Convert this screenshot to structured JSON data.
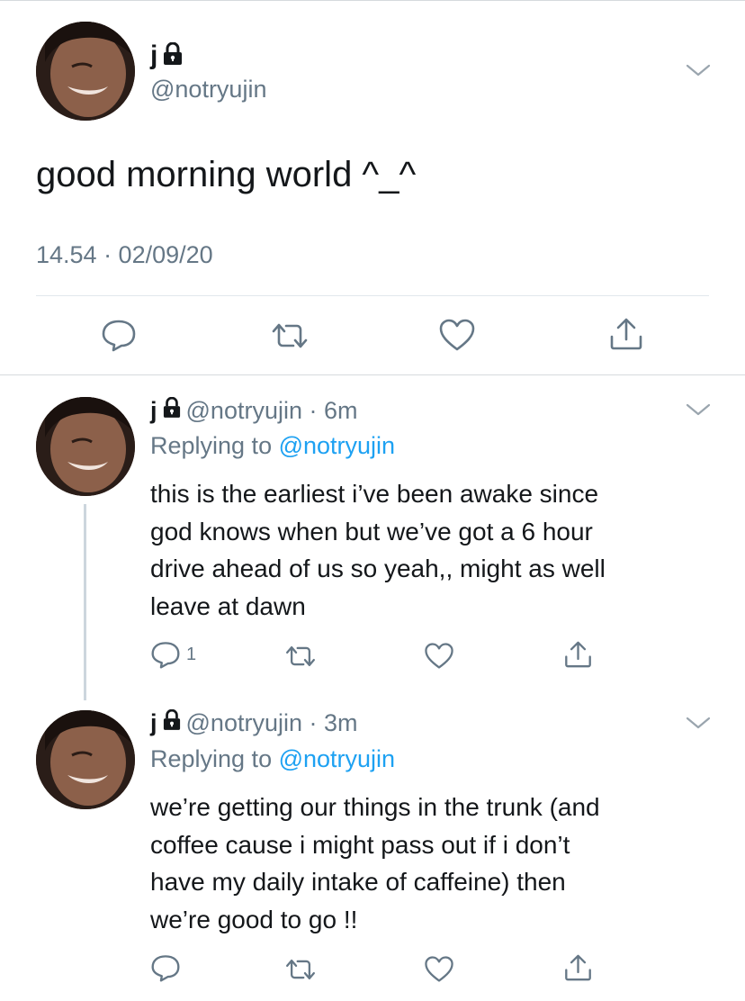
{
  "main_tweet": {
    "display_name": "j",
    "handle": "@notryujin",
    "text": "good morning world ^_^",
    "timestamp": "14.54 · 02/09/20",
    "icons": [
      "lock-icon",
      "chevron-down-icon",
      "reply-icon",
      "retweet-icon",
      "like-icon",
      "share-icon"
    ]
  },
  "replies": [
    {
      "display_name": "j",
      "handle_time": "@notryujin · 6m",
      "replying_prefix": "Replying to",
      "replying_handle": "@notryujin",
      "lines": [
        "this is the earliest i’ve been awake since",
        "god knows when but we’ve got a 6 hour",
        "drive ahead of us so yeah,, might as well",
        "leave at dawn"
      ],
      "reply_count": "1"
    },
    {
      "display_name": "j",
      "handle_time": "@notryujin · 3m",
      "replying_prefix": "Replying to",
      "replying_handle": "@notryujin",
      "lines": [
        "we’re getting our things in the trunk (and",
        "coffee cause i might pass out if i don’t",
        "have my daily intake of caffeine) then",
        "we’re good to go !!"
      ],
      "reply_count": ""
    }
  ],
  "colors": {
    "text": "#14171a",
    "secondary": "#657786",
    "link": "#1da1f2",
    "divider": "#e1e8ed",
    "thread_line": "#ccd6dd"
  }
}
